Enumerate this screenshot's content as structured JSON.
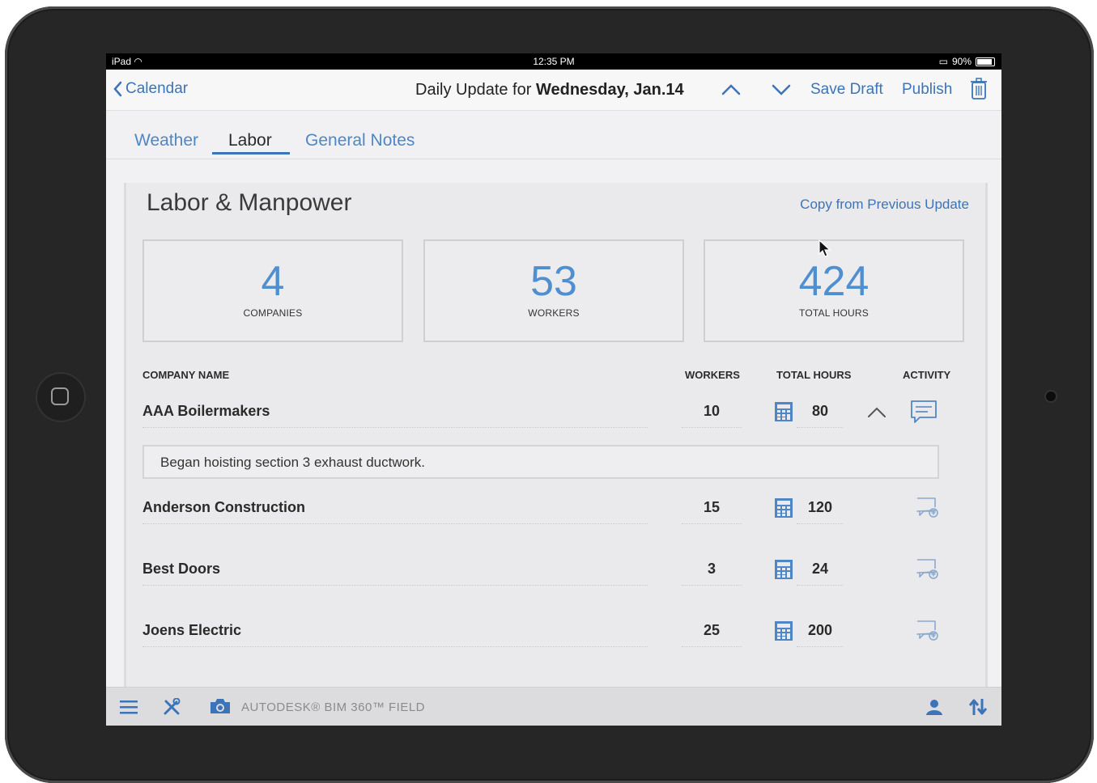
{
  "status_bar": {
    "device": "iPad",
    "time": "12:35 PM",
    "battery": "90%"
  },
  "nav": {
    "back_label": "Calendar",
    "title_prefix": "Daily Update for ",
    "title_date": "Wednesday, Jan.14",
    "save_draft": "Save Draft",
    "publish": "Publish"
  },
  "tabs": [
    {
      "label": "Weather",
      "active": false
    },
    {
      "label": "Labor",
      "active": true
    },
    {
      "label": "General Notes",
      "active": false
    }
  ],
  "labor": {
    "title": "Labor & Manpower",
    "copy_link": "Copy from Previous Update",
    "stats": [
      {
        "value": "4",
        "label": "COMPANIES"
      },
      {
        "value": "53",
        "label": "WORKERS"
      },
      {
        "value": "424",
        "label": "TOTAL HOURS"
      }
    ],
    "headers": {
      "company": "COMPANY NAME",
      "workers": "WORKERS",
      "hours": "TOTAL HOURS",
      "activity": "ACTIVITY"
    },
    "rows": [
      {
        "company": "AAA Boilermakers",
        "workers": "10",
        "hours": "80",
        "expanded": true,
        "activity_note": "Began hoisting section 3 exhaust ductwork."
      },
      {
        "company": "Anderson Construction",
        "workers": "15",
        "hours": "120",
        "expanded": false
      },
      {
        "company": "Best Doors",
        "workers": "3",
        "hours": "24",
        "expanded": false
      },
      {
        "company": "Joens Electric",
        "workers": "25",
        "hours": "200",
        "expanded": false
      }
    ]
  },
  "toolbar": {
    "brand": "AUTODESK® BIM 360™ FIELD"
  },
  "colors": {
    "accent": "#3b74b8",
    "stat_number": "#4f8fd0",
    "device_frame": "#262626"
  }
}
